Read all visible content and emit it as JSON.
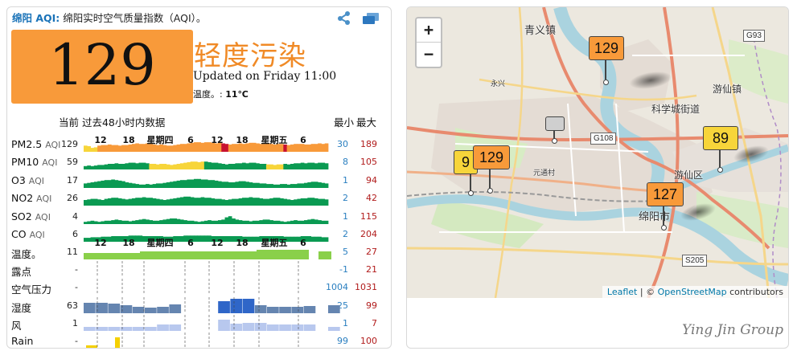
{
  "header": {
    "city": "绵阳 AQI:",
    "title": " 绵阳实时空气质量指数（AQI）。"
  },
  "current": {
    "aqi": "129",
    "level": "轻度污染",
    "updated": "Updated on Friday 11:00",
    "temp_label": "温度。: ",
    "temp_value": "11℃",
    "box_color": "#f89a3a"
  },
  "table": {
    "caption": "当前 过去48小时内数据",
    "min_label": "最小",
    "max_label": "最大",
    "time_labels": [
      "12",
      "18",
      "星期四",
      "6",
      "12",
      "18",
      "星期五",
      "6"
    ],
    "rows": [
      {
        "name": "PM2.5",
        "sub": "AQI",
        "cur": "129",
        "min": "30",
        "max": "189",
        "kind": "aqi",
        "values": [
          0.55,
          0.5,
          0.35,
          0.4,
          0.55,
          0.6,
          0.6,
          0.65,
          0.6,
          0.6,
          0.55,
          0.6,
          0.6,
          0.65,
          0.7,
          0.75,
          0.7,
          0.7,
          0.75,
          0.7,
          0.65,
          0.6,
          0.65,
          0.6,
          0.55,
          0.55,
          0.6,
          0.65,
          0.7,
          0.7,
          0.75,
          0.8,
          0.85,
          0.85,
          0.8,
          0.85,
          0.85,
          0.8,
          0.75,
          0.8,
          0.75,
          0.7,
          0.65,
          0.7,
          0.7,
          0.75,
          0.7,
          0.75,
          0.8,
          0.8,
          0.75,
          0.7,
          0.7,
          0.75,
          0.7,
          0.65,
          0.7,
          0.7,
          0.65,
          0.6,
          0.65,
          0.7,
          0.7,
          0.7,
          0.65,
          0.65,
          0.7,
          0.7,
          0.75,
          0.7,
          0.75
        ]
      },
      {
        "name": "PM10",
        "sub": "AQI",
        "cur": "59",
        "min": "8",
        "max": "105",
        "kind": "aqi",
        "values": [
          0.3,
          0.35,
          0.3,
          0.35,
          0.4,
          0.4,
          0.45,
          0.5,
          0.5,
          0.55,
          0.5,
          0.5,
          0.55,
          0.6,
          0.6,
          0.55,
          0.6,
          0.6,
          0.55,
          0.5,
          0.5,
          0.45,
          0.5,
          0.5,
          0.45,
          0.4,
          0.45,
          0.5,
          0.55,
          0.6,
          0.65,
          0.7,
          0.7,
          0.65,
          0.7,
          0.7,
          0.65,
          0.6,
          0.6,
          0.55,
          0.5,
          0.45,
          0.5,
          0.5,
          0.55,
          0.55,
          0.6,
          0.55,
          0.6,
          0.6,
          0.55,
          0.5,
          0.5,
          0.45,
          0.45,
          0.4,
          0.45,
          0.45,
          0.5,
          0.45,
          0.5,
          0.55,
          0.55,
          0.6,
          0.55,
          0.6,
          0.6,
          0.55,
          0.6,
          0.6,
          0.55
        ]
      },
      {
        "name": "O3",
        "sub": "AQI",
        "cur": "17",
        "min": "1",
        "max": "94",
        "kind": "aqi",
        "values": [
          0.4,
          0.45,
          0.5,
          0.55,
          0.6,
          0.65,
          0.7,
          0.7,
          0.75,
          0.7,
          0.65,
          0.6,
          0.5,
          0.45,
          0.4,
          0.35,
          0.3,
          0.3,
          0.35,
          0.3,
          0.35,
          0.4,
          0.4,
          0.45,
          0.5,
          0.55,
          0.6,
          0.65,
          0.7,
          0.7,
          0.75,
          0.75,
          0.8,
          0.8,
          0.75,
          0.75,
          0.7,
          0.7,
          0.65,
          0.6,
          0.55,
          0.55,
          0.5,
          0.5,
          0.55,
          0.6,
          0.6,
          0.55,
          0.5,
          0.45,
          0.45,
          0.4,
          0.4,
          0.35,
          0.35,
          0.3,
          0.3,
          0.35,
          0.35,
          0.3,
          0.35,
          0.35,
          0.4,
          0.4,
          0.45,
          0.5,
          0.55,
          0.55,
          0.5,
          0.45,
          0.4
        ]
      },
      {
        "name": "NO2",
        "sub": "AQI",
        "cur": "26",
        "min": "2",
        "max": "42",
        "kind": "aqi",
        "values": [
          0.5,
          0.55,
          0.6,
          0.6,
          0.55,
          0.5,
          0.6,
          0.65,
          0.7,
          0.7,
          0.65,
          0.6,
          0.55,
          0.6,
          0.65,
          0.7,
          0.7,
          0.75,
          0.7,
          0.7,
          0.65,
          0.6,
          0.55,
          0.5,
          0.55,
          0.6,
          0.65,
          0.7,
          0.75,
          0.8,
          0.8,
          0.75,
          0.7,
          0.7,
          0.75,
          0.7,
          0.7,
          0.65,
          0.6,
          0.6,
          0.55,
          0.5,
          0.55,
          0.6,
          0.6,
          0.65,
          0.7,
          0.7,
          0.75,
          0.7,
          0.7,
          0.65,
          0.6,
          0.6,
          0.65,
          0.7,
          0.7,
          0.65,
          0.6,
          0.55,
          0.5,
          0.55,
          0.6,
          0.65,
          0.65,
          0.7,
          0.7,
          0.65,
          0.6,
          0.6,
          0.55
        ]
      },
      {
        "name": "SO2",
        "sub": "AQI",
        "cur": "4",
        "min": "1",
        "max": "115",
        "kind": "aqi",
        "values": [
          0.2,
          0.25,
          0.3,
          0.25,
          0.2,
          0.25,
          0.3,
          0.3,
          0.35,
          0.4,
          0.35,
          0.3,
          0.3,
          0.25,
          0.3,
          0.35,
          0.4,
          0.45,
          0.4,
          0.35,
          0.3,
          0.3,
          0.35,
          0.4,
          0.45,
          0.5,
          0.5,
          0.45,
          0.4,
          0.35,
          0.3,
          0.3,
          0.25,
          0.2,
          0.25,
          0.3,
          0.35,
          0.3,
          0.3,
          0.35,
          0.4,
          0.6,
          0.7,
          0.5,
          0.4,
          0.35,
          0.3,
          0.3,
          0.25,
          0.3,
          0.3,
          0.35,
          0.4,
          0.4,
          0.35,
          0.3,
          0.3,
          0.25,
          0.2,
          0.25,
          0.3,
          0.35,
          0.3,
          0.3,
          0.35,
          0.4,
          0.45,
          0.4,
          0.35,
          0.3,
          0.3
        ]
      },
      {
        "name": "CO",
        "sub": "AQI",
        "cur": "6",
        "min": "2",
        "max": "204",
        "kind": "aqi",
        "values": [
          0.35,
          0.35,
          0.4,
          0.4,
          0.4,
          0.45,
          0.45,
          0.45,
          0.5,
          0.5,
          0.5,
          0.5,
          0.5,
          0.55,
          0.55,
          0.55,
          0.55,
          0.5,
          0.5,
          0.5,
          0.5,
          0.5,
          0.5,
          0.45,
          0.45,
          0.45,
          0.5,
          0.5,
          0.5,
          0.55,
          0.55,
          0.55,
          0.55,
          0.55,
          0.55,
          0.55,
          0.55,
          0.5,
          0.5,
          0.5,
          0.5,
          0.5,
          0.5,
          0.5,
          0.5,
          0.5,
          0.45,
          0.45,
          0.45,
          0.45,
          0.45,
          0.5,
          0.5,
          0.5,
          0.5,
          0.5,
          0.5,
          0.5,
          0.45,
          0.45,
          0.45,
          0.45,
          0.45,
          0.5,
          0.5,
          0.5,
          0.45,
          0.45,
          0.45,
          0.4,
          0.4
        ]
      },
      {
        "name": "温度。",
        "sub": "",
        "cur": "11",
        "min": "5",
        "max": "27",
        "kind": "temp"
      },
      {
        "name": "露点",
        "sub": "",
        "cur": "-",
        "min": "-1",
        "max": "21",
        "kind": "grid"
      },
      {
        "name": "空气压力",
        "sub": "",
        "cur": "-",
        "min": "1004",
        "max": "1031",
        "kind": "grid"
      },
      {
        "name": "湿度",
        "sub": "",
        "cur": "63",
        "min": "25",
        "max": "99",
        "kind": "humidity"
      },
      {
        "name": "风",
        "sub": "",
        "cur": "1",
        "min": "1",
        "max": "7",
        "kind": "wind"
      },
      {
        "name": "Rain",
        "sub": "",
        "cur": "-",
        "min": "99",
        "max": "100",
        "kind": "rain"
      }
    ]
  },
  "colors": {
    "good": "#0a9a52",
    "moderate": "#f7d53a",
    "sensitive": "#f89a3a",
    "unhealthy": "#c8102e",
    "temp": "#8ad04a",
    "humidity": "#4a7fc0",
    "wind": "#b8c8ee",
    "rain": "#f5d000"
  },
  "map": {
    "zoom_in": "+",
    "zoom_out": "−",
    "attribution_leaflet": "Leaflet",
    "attribution_sep": " | © ",
    "attribution_osm": "OpenStreetMap",
    "attribution_tail": " contributors",
    "labels": {
      "qingyi": "青义镇",
      "yongxing": "永兴",
      "kexue": "科学城街道",
      "youxianzhen": "游仙镇",
      "yuantong": "元通村",
      "youxianqu": "游仙区",
      "mianyang": "绵阳市"
    },
    "shields": {
      "g93": "G93",
      "g108": "G108",
      "s205": "S205"
    },
    "markers": [
      {
        "value": "129",
        "color": "#f89a3a"
      },
      {
        "value": "89",
        "color": "#f7d53a"
      },
      {
        "value": "9",
        "color": "#f7d53a"
      },
      {
        "value": "129",
        "color": "#f89a3a"
      },
      {
        "value": "127",
        "color": "#f89a3a"
      },
      {
        "value": "",
        "color": "#cfcfcf"
      }
    ]
  },
  "signature": "Ying Jin Group"
}
